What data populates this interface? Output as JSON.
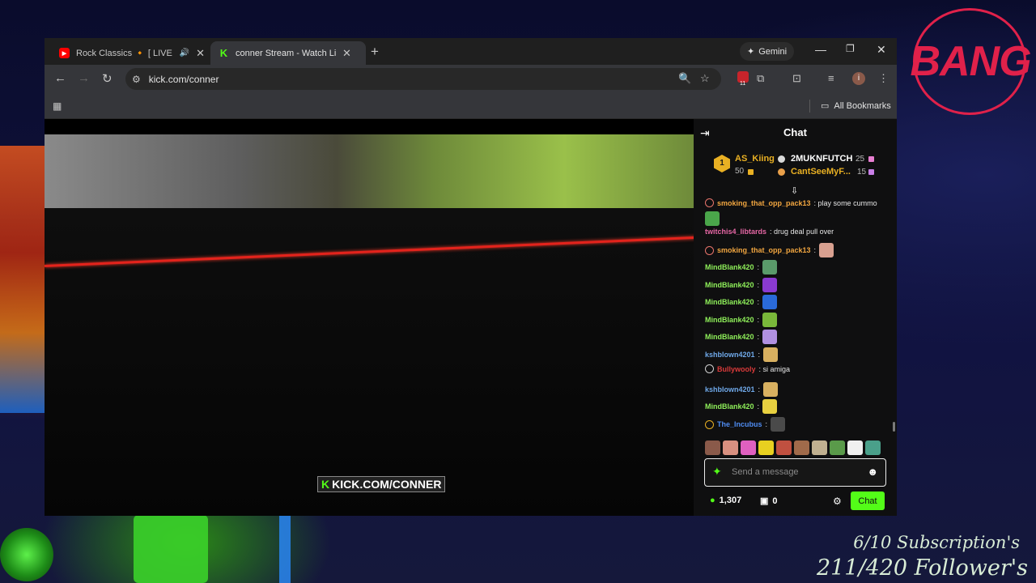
{
  "browser": {
    "tabs": [
      {
        "title": "Rock Classics 🔸 [ LIVE ] Ti",
        "favicon": "youtube-icon",
        "active": false
      },
      {
        "title": "conner Stream - Watch Live on",
        "favicon": "kick-icon",
        "active": true
      }
    ],
    "gemini_label": "Gemini",
    "url": "kick.com/conner",
    "extension_badge_count": "11",
    "profile_initial": "i",
    "all_bookmarks_label": "All Bookmarks"
  },
  "video": {
    "watermark": "KICK.COM/CONNER"
  },
  "chat": {
    "title": "Chat",
    "leaders": [
      {
        "rank": "1",
        "name": "AS_Kiing",
        "count": "50"
      },
      {
        "name": "2MUKNFUTCH",
        "count": "25"
      },
      {
        "name": "CantSeeMyF...",
        "count": "15"
      }
    ],
    "messages": [
      {
        "user": "smoking_that_opp_pack13",
        "text": ": play some cummo",
        "color": "#f2a640",
        "badge": true,
        "emote": "pepe-emote"
      },
      {
        "user": "twitchis4_libtards",
        "text": ": drug deal pull over",
        "color": "#e667a5",
        "badge": false
      },
      {
        "user": "smoking_that_opp_pack13",
        "text": ":",
        "color": "#f2a640",
        "badge": true,
        "emote": "face-emote"
      },
      {
        "user": "MindBlank420",
        "text": ":",
        "color": "#8ff05a",
        "badge": false,
        "emote": "frog-emote"
      },
      {
        "user": "MindBlank420",
        "text": ":",
        "color": "#8ff05a",
        "badge": false,
        "emote": "purple-emote"
      },
      {
        "user": "MindBlank420",
        "text": ":",
        "color": "#8ff05a",
        "badge": false,
        "emote": "blue-emote"
      },
      {
        "user": "MindBlank420",
        "text": ":",
        "color": "#8ff05a",
        "badge": false,
        "emote": "green-emote"
      },
      {
        "user": "MindBlank420",
        "text": ":",
        "color": "#8ff05a",
        "badge": false,
        "emote": "violet-emote"
      },
      {
        "user": "kshblown4201",
        "text": ":",
        "color": "#6fa8e8",
        "badge": false,
        "emote": "cat-emote"
      },
      {
        "user": "Bullywooly",
        "text": ": si amiga",
        "color": "#d93a3a",
        "badge": true
      },
      {
        "user": "kshblown4201",
        "text": ":",
        "color": "#6fa8e8",
        "badge": false,
        "emote": "cat-emote"
      },
      {
        "user": "MindBlank420",
        "text": ":",
        "color": "#8ff05a",
        "badge": false,
        "emote": "yellow-emote"
      },
      {
        "user": "The_Incubus",
        "text": ":",
        "color": "#4f8cf2",
        "badge": true,
        "emote": "dark-emote"
      }
    ],
    "input_placeholder": "Send a message",
    "viewer_count": "1,307",
    "store_count": "0",
    "chat_button": "Chat"
  },
  "overlay": {
    "badge_text": "BANG",
    "subscriptions": "6/10 Subscription's",
    "followers": "211/420 Follower's"
  },
  "colors": {
    "kick_green": "#53fc18",
    "accent_red": "#e0214a",
    "leader_gold": "#e9b023"
  }
}
